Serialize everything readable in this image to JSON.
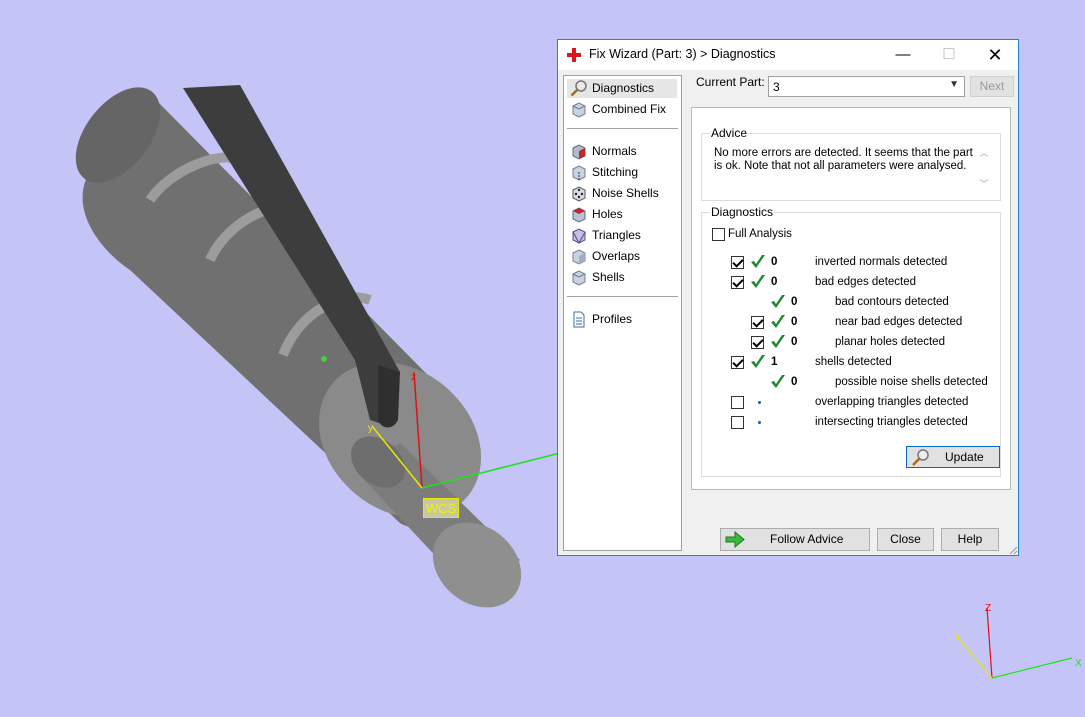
{
  "viewport": {
    "wcs_label": "WCS",
    "triad": {
      "x": "X",
      "y": "Y",
      "z": "Z"
    }
  },
  "dialog": {
    "title": "Fix Wizard (Part: 3) > Diagnostics",
    "window_buttons": {
      "minimize": "—",
      "maximize": "☐",
      "close": "✕"
    },
    "sidebar": {
      "items": [
        {
          "label": "Diagnostics",
          "icon": "magnifier-icon",
          "selected": true
        },
        {
          "label": "Combined Fix",
          "icon": "cube-icon"
        },
        {
          "label": "Normals",
          "icon": "normals-cube-icon"
        },
        {
          "label": "Stitching",
          "icon": "stitching-cube-icon"
        },
        {
          "label": "Noise Shells",
          "icon": "dice-icon"
        },
        {
          "label": "Holes",
          "icon": "holes-cube-icon"
        },
        {
          "label": "Triangles",
          "icon": "triangles-icon"
        },
        {
          "label": "Overlaps",
          "icon": "overlaps-cube-icon"
        },
        {
          "label": "Shells",
          "icon": "shells-cube-icon"
        },
        {
          "label": "Profiles",
          "icon": "document-icon"
        }
      ]
    },
    "current_part": {
      "label": "Current Part:",
      "value": "3"
    },
    "next_label": "Next",
    "advice": {
      "title": "Advice",
      "text": "No more errors are detected. It seems that the part is ok. Note that not all parameters were analysed."
    },
    "diagnostics": {
      "title": "Diagnostics",
      "full_analysis_label": "Full Analysis",
      "full_analysis_checked": false,
      "rows": [
        {
          "checked": true,
          "status": "ok",
          "count": "0",
          "label": "inverted normals detected",
          "level": 0
        },
        {
          "checked": true,
          "status": "ok",
          "count": "0",
          "label": "bad edges detected",
          "level": 0
        },
        {
          "checked": null,
          "status": "ok",
          "count": "0",
          "label": "bad contours detected",
          "level": 1
        },
        {
          "checked": true,
          "status": "ok",
          "count": "0",
          "label": "near bad edges detected",
          "level": 1
        },
        {
          "checked": true,
          "status": "ok",
          "count": "0",
          "label": "planar holes detected",
          "level": 1
        },
        {
          "checked": true,
          "status": "ok",
          "count": "1",
          "label": "shells detected",
          "level": 0
        },
        {
          "checked": null,
          "status": "ok",
          "count": "0",
          "label": "possible noise shells detected",
          "level": 1
        },
        {
          "checked": false,
          "status": "pending",
          "count": "",
          "label": "overlapping triangles detected",
          "level": 0
        },
        {
          "checked": false,
          "status": "pending",
          "count": "",
          "label": "intersecting triangles detected",
          "level": 0
        }
      ],
      "update_label": "Update"
    },
    "footer": {
      "follow_advice_label": "Follow Advice",
      "close_label": "Close",
      "help_label": "Help"
    },
    "colors": {
      "accent": "#1883d7",
      "check_green": "#1e8a2e",
      "background": "#c4c4f6"
    }
  }
}
